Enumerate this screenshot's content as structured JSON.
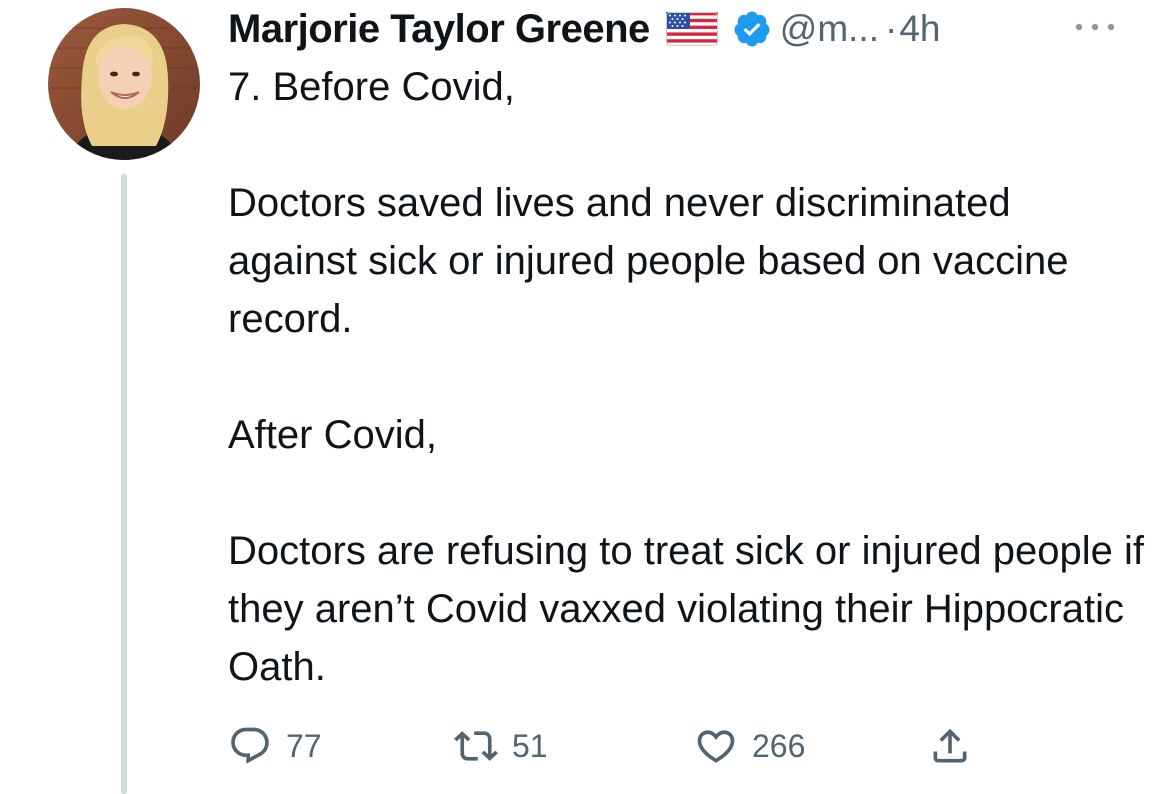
{
  "tweet": {
    "author": {
      "display_name": "Marjorie Taylor Greene",
      "flag_emoji": "us-flag-icon",
      "verified": true,
      "handle": "@m...",
      "separator": "·",
      "timestamp": "4h"
    },
    "body": [
      "7. Before Covid,",
      "",
      "Doctors saved lives and never discriminated against sick or injured people based on vaccine record.",
      "",
      "After Covid,",
      "",
      "Doctors are refusing to treat sick or injured people if they aren’t Covid vaxxed violating their Hippocratic Oath."
    ],
    "actions": {
      "reply_count": "77",
      "retweet_count": "51",
      "like_count": "266"
    }
  },
  "icons": {
    "avatar": "avatar",
    "more": "more-horizontal-icon",
    "reply": "reply-icon",
    "retweet": "retweet-icon",
    "like": "heart-icon",
    "share": "share-icon",
    "verified": "verified-badge-icon"
  },
  "colors": {
    "text": "#0f1419",
    "secondary": "#536471",
    "verified": "#1d9bf0",
    "thread_line": "#cfd9de"
  }
}
